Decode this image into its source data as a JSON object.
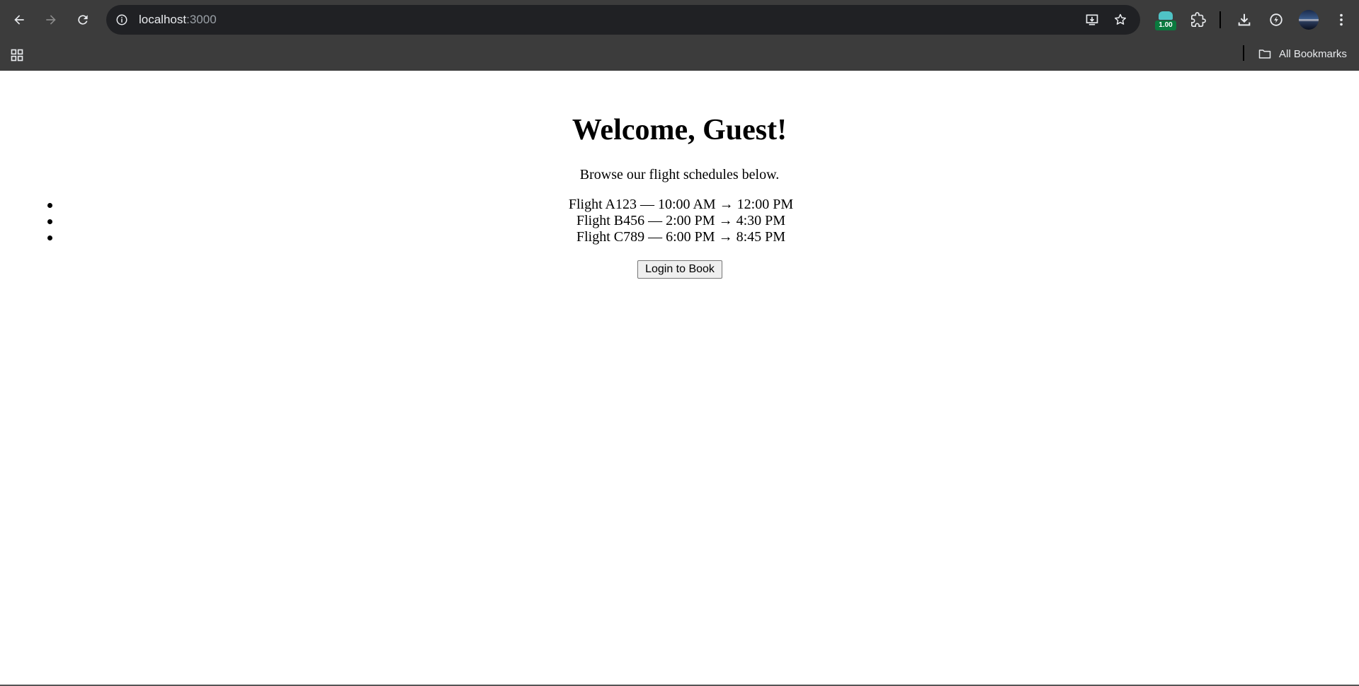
{
  "browser": {
    "url_host": "localhost",
    "url_port": ":3000",
    "extension_badge": "1.00",
    "all_bookmarks_label": "All Bookmarks"
  },
  "page": {
    "heading": "Welcome, Guest!",
    "intro": "Browse our flight schedules below.",
    "flights": [
      "Flight A123 — 10:00 AM → 12:00 PM",
      "Flight B456 — 2:00 PM → 4:30 PM",
      "Flight C789 — 6:00 PM → 8:45 PM"
    ],
    "login_button_label": "Login to Book"
  }
}
